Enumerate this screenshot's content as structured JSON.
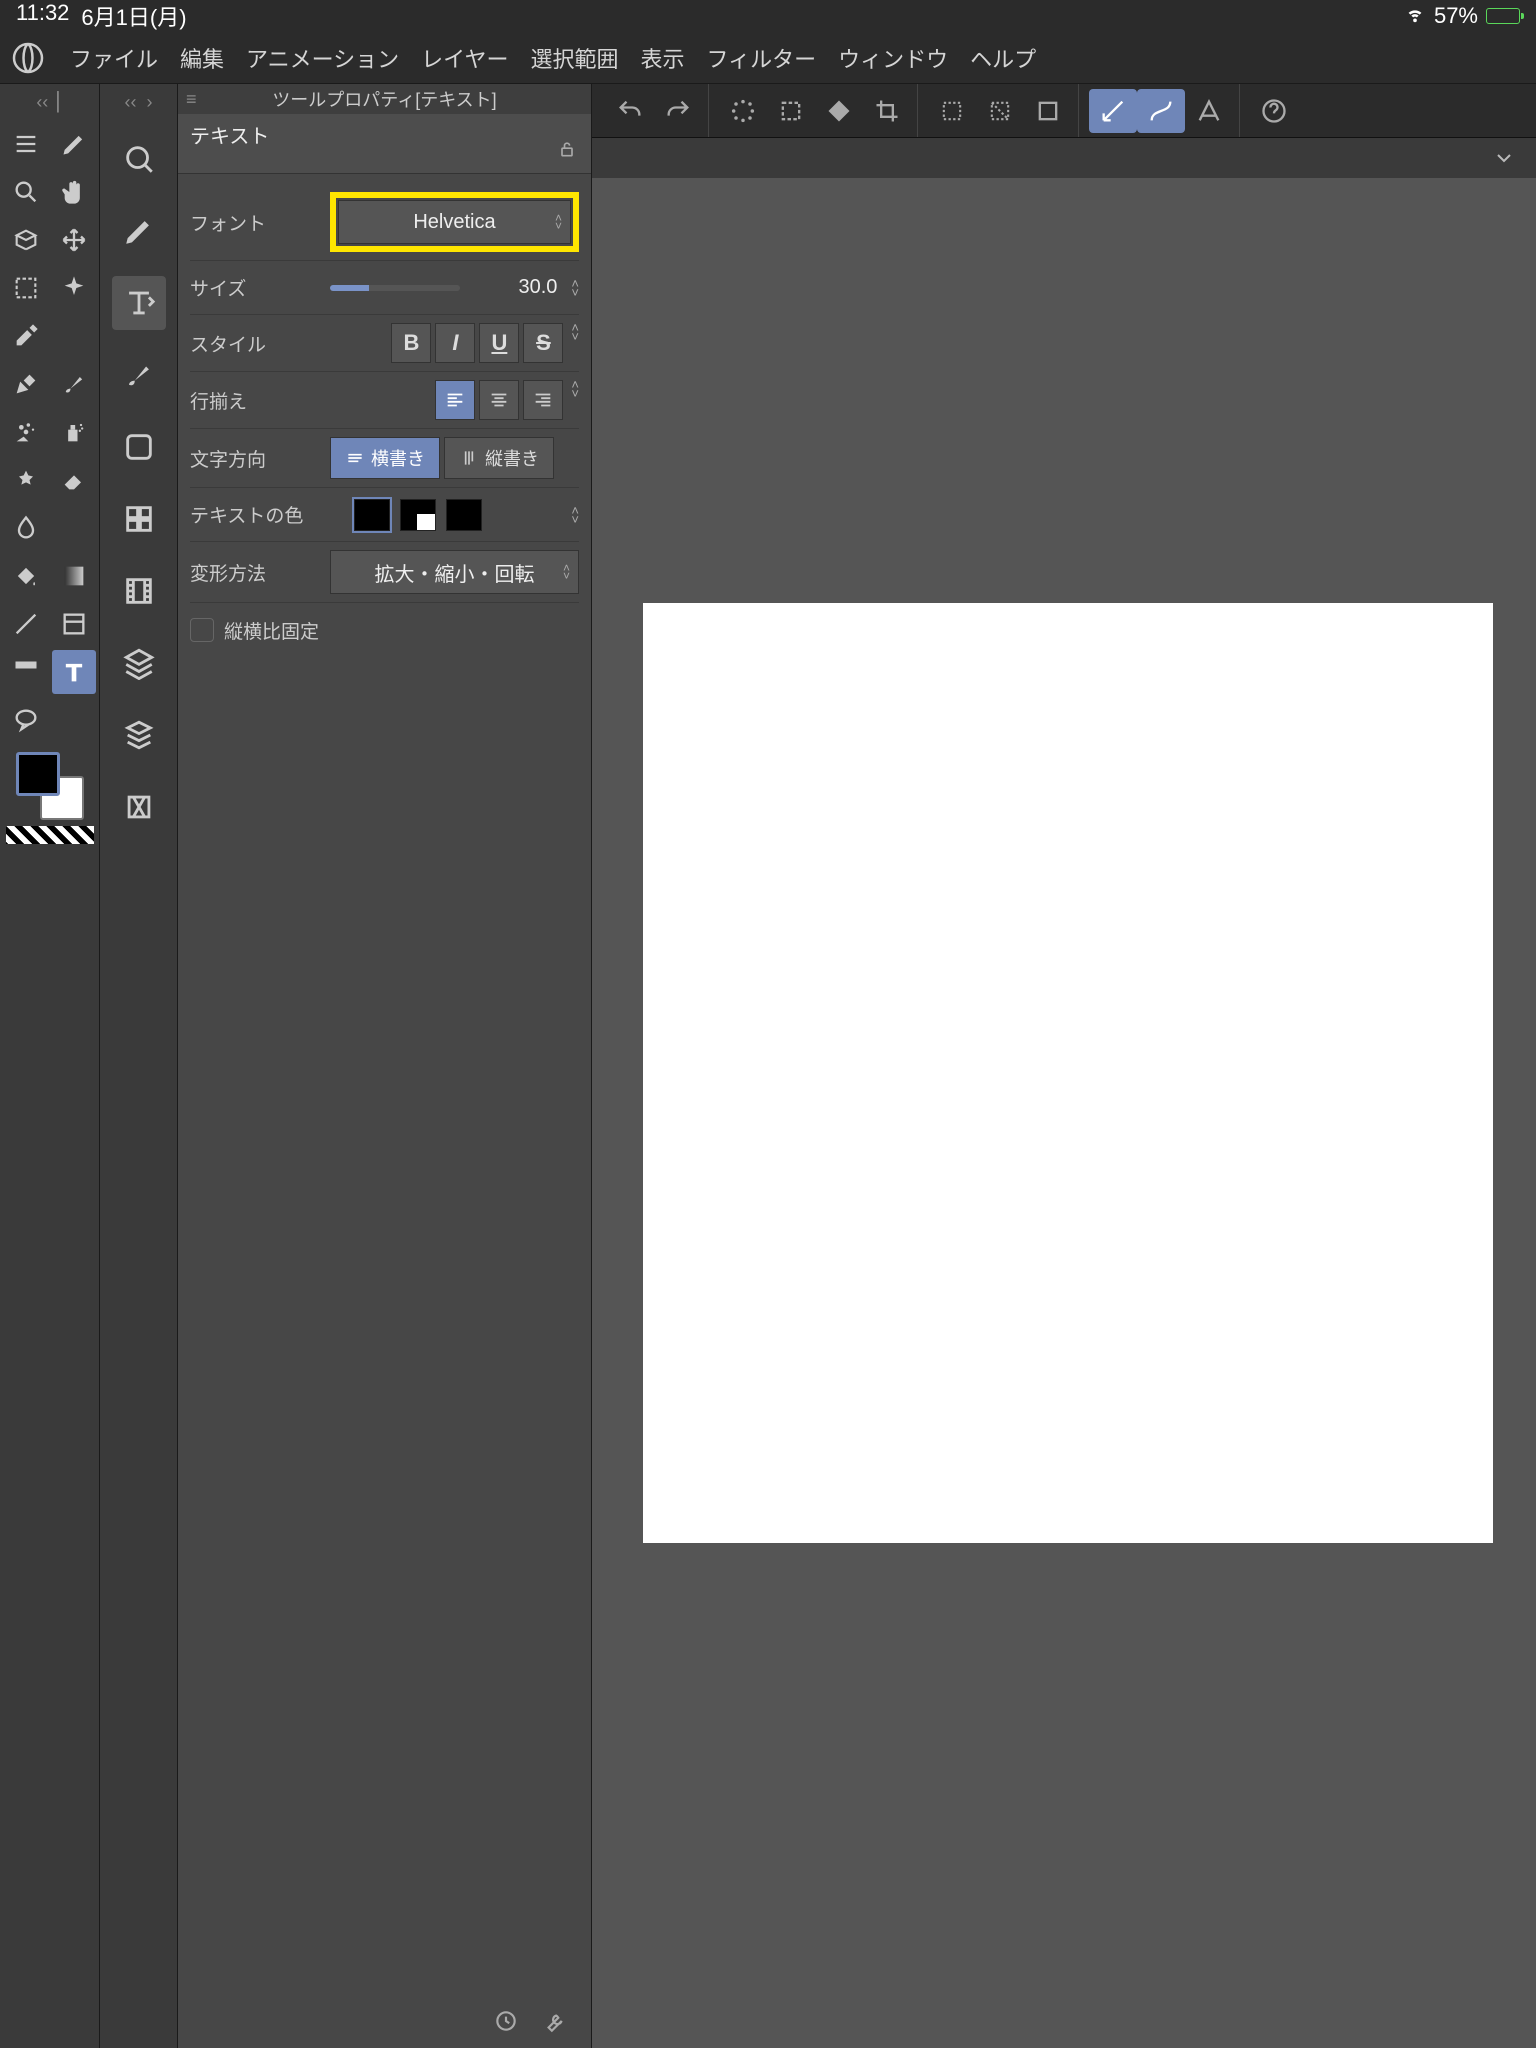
{
  "status": {
    "time": "11:32",
    "date": "6月1日(月)",
    "battery_pct": "57%"
  },
  "menu": {
    "items": [
      "ファイル",
      "編集",
      "アニメーション",
      "レイヤー",
      "選択範囲",
      "表示",
      "フィルター",
      "ウィンドウ",
      "ヘルプ"
    ]
  },
  "panel": {
    "title": "ツールプロパティ[テキスト]",
    "header": "テキスト",
    "rows": {
      "font_label": "フォント",
      "font_value": "Helvetica",
      "size_label": "サイズ",
      "size_value": "30.0",
      "style_label": "スタイル",
      "align_label": "行揃え",
      "direction_label": "文字方向",
      "dir_horizontal": "横書き",
      "dir_vertical": "縦書き",
      "color_label": "テキストの色",
      "transform_label": "変形方法",
      "transform_value": "拡大・縮小・回転",
      "aspect_label": "縦横比固定"
    }
  },
  "style_buttons": {
    "bold": "B",
    "italic": "I",
    "underline": "U",
    "strike": "S"
  }
}
